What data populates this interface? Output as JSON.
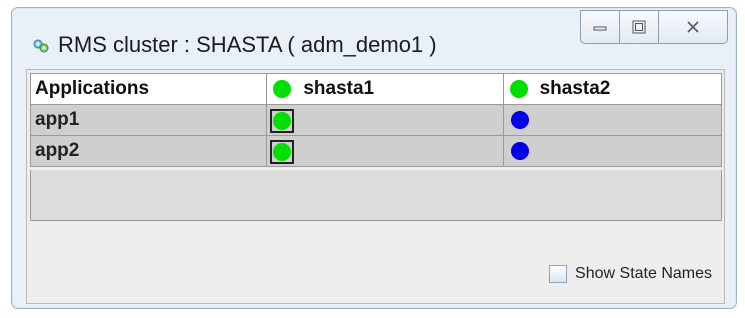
{
  "window": {
    "title": "RMS cluster : SHASTA ( adm_demo1 )",
    "icon": "cluster-icon"
  },
  "table": {
    "header_label": "Applications",
    "nodes": [
      {
        "name": "shasta1",
        "status_color": "#00e000"
      },
      {
        "name": "shasta2",
        "status_color": "#00e000"
      }
    ],
    "rows": [
      {
        "app": "app1",
        "states": [
          "green-boxed",
          "blue"
        ]
      },
      {
        "app": "app2",
        "states": [
          "green-boxed",
          "blue"
        ]
      }
    ]
  },
  "footer": {
    "show_state_names_label": "Show State Names",
    "show_state_names_checked": false
  },
  "colors": {
    "online": "#00e000",
    "offline": "#0000e6"
  }
}
